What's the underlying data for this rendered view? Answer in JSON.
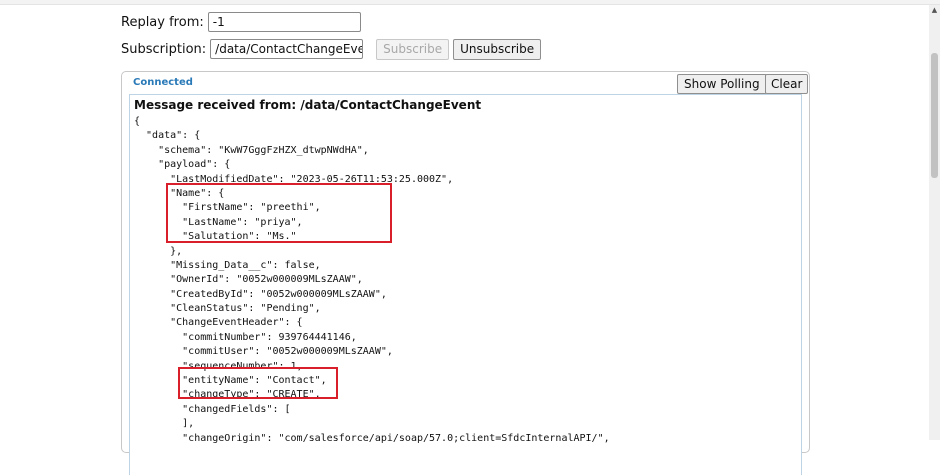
{
  "form": {
    "replay_label": "Replay from:",
    "replay_value": "-1",
    "subscription_label": "Subscription:",
    "subscription_value": "/data/ContactChangeEvent",
    "subscribe_label": "Subscribe",
    "unsubscribe_label": "Unsubscribe"
  },
  "panel": {
    "status": "Connected",
    "show_polling_label": "Show Polling",
    "clear_label": "Clear"
  },
  "message": {
    "title": "Message received from: /data/ContactChangeEvent",
    "lines": [
      "{",
      "  \"data\": {",
      "    \"schema\": \"KwW7GggFzHZX_dtwpNWdHA\",",
      "    \"payload\": {",
      "      \"LastModifiedDate\": \"2023-05-26T11:53:25.000Z\",",
      "      \"Name\": {",
      "        \"FirstName\": \"preethi\",",
      "        \"LastName\": \"priya\",",
      "        \"Salutation\": \"Ms.\"",
      "      },",
      "      \"Missing_Data__c\": false,",
      "      \"OwnerId\": \"0052w000009MLsZAAW\",",
      "      \"CreatedById\": \"0052w000009MLsZAAW\",",
      "      \"CleanStatus\": \"Pending\",",
      "      \"ChangeEventHeader\": {",
      "        \"commitNumber\": 939764441146,",
      "        \"commitUser\": \"0052w000009MLsZAAW\",",
      "        \"sequenceNumber\": 1,",
      "        \"entityName\": \"Contact\",",
      "        \"changeType\": \"CREATE\",",
      "        \"changedFields\": [",
      "        ],",
      "        \"changeOrigin\": \"com/salesforce/api/soap/57.0;client=SfdcInternalAPI/\","
    ]
  },
  "highlight_color": "#d9202a"
}
